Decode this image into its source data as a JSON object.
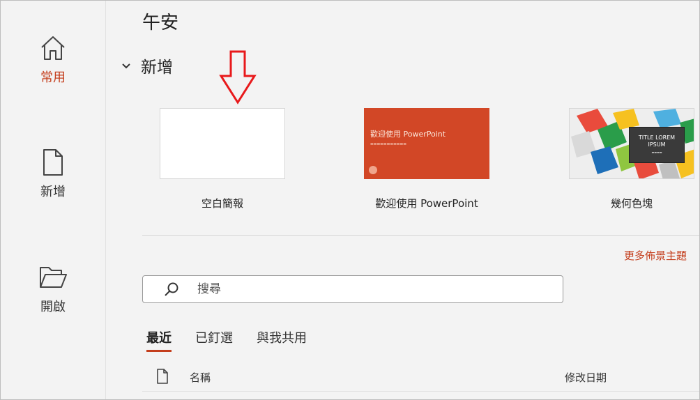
{
  "sidebar": {
    "items": [
      {
        "label": "常用",
        "icon": "home-icon",
        "active": true
      },
      {
        "label": "新增",
        "icon": "new-document-icon",
        "active": false
      },
      {
        "label": "開啟",
        "icon": "open-folder-icon",
        "active": false
      }
    ]
  },
  "main": {
    "greeting": "午安",
    "new_section": {
      "title": "新增",
      "templates": [
        {
          "label": "空白簡報",
          "thumb": "blank"
        },
        {
          "label": "歡迎使用 PowerPoint",
          "thumb": "powerpoint-welcome",
          "thumb_title": "歡迎使用 PowerPoint"
        },
        {
          "label": "幾何色塊",
          "thumb": "geometric-blocks",
          "thumb_title": "TITLE LOREM IPSUM"
        }
      ],
      "more_themes": "更多佈景主題"
    },
    "search": {
      "placeholder": "搜尋"
    },
    "tabs": [
      {
        "label": "最近",
        "active": true
      },
      {
        "label": "已釘選",
        "active": false
      },
      {
        "label": "與我共用",
        "active": false
      }
    ],
    "list_header": {
      "name": "名稱",
      "modified": "修改日期"
    }
  },
  "colors": {
    "accent": "#c43e1c",
    "powerpoint_orange": "#d24726",
    "annotation_red": "#e8191b"
  }
}
